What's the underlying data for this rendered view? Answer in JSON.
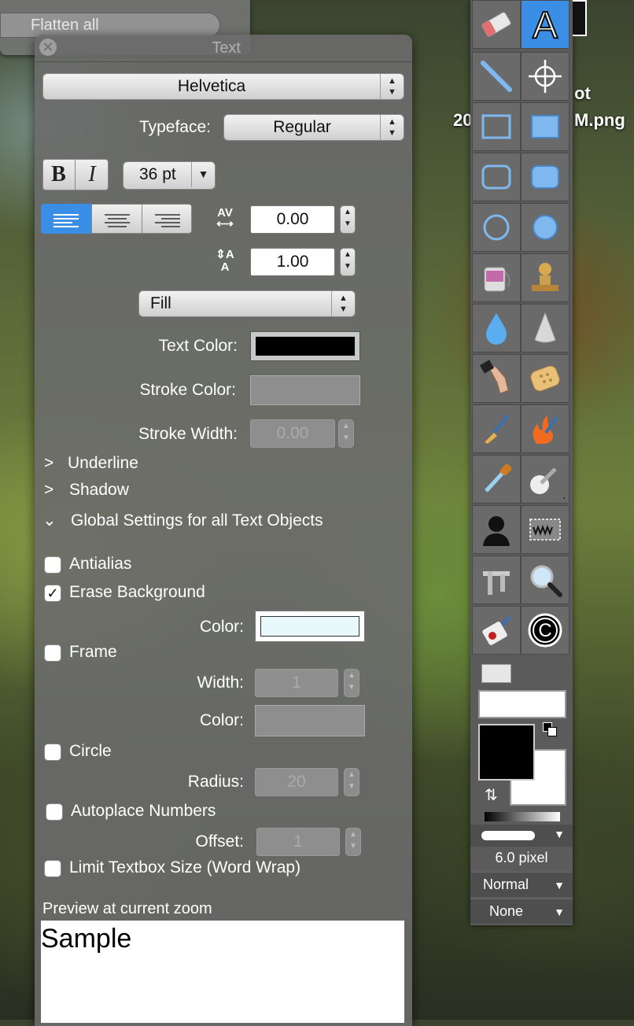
{
  "background_window": {
    "flatten_label": "Flatten all"
  },
  "desktop": {
    "file_label_line1": "ot",
    "file_label_line2_left": "20",
    "file_label_line2_right": "M.png"
  },
  "panel": {
    "title": "Text",
    "font_name": "Helvetica",
    "typeface_label": "Typeface:",
    "typeface_value": "Regular",
    "bold_label": "B",
    "italic_label": "I",
    "font_size": "36 pt",
    "tracking_value": "0.00",
    "line_spacing_value": "1.00",
    "fill_mode": "Fill",
    "text_color_label": "Text Color:",
    "stroke_color_label": "Stroke Color:",
    "stroke_width_label": "Stroke Width:",
    "stroke_width_value": "0.00",
    "underline_label": "Underline",
    "shadow_label": "Shadow",
    "global_settings_label": "Global Settings for all Text Objects",
    "antialias_label": "Antialias",
    "erase_background_label": "Erase Background",
    "color_label": "Color:",
    "frame_label": "Frame",
    "width_label": "Width:",
    "frame_width_value": "1",
    "frame_color_label": "Color:",
    "circle_label": "Circle",
    "radius_label": "Radius:",
    "radius_value": "20",
    "autoplace_label": "Autoplace Numbers",
    "offset_label": "Offset:",
    "offset_value": "1",
    "limit_textbox_label": "Limit Textbox Size (Word Wrap)",
    "preview_label": "Preview at current zoom",
    "preview_sample": "Sample",
    "checks": {
      "antialias": false,
      "erase_background": true,
      "frame": false,
      "circle": false,
      "autoplace": false,
      "limit_textbox": false
    }
  },
  "toolbox": {
    "brush_size": "6.0 pixel",
    "blend_mode": "Normal",
    "fill_option": "None"
  },
  "colors": {
    "text_color": "#000000",
    "erase_bg_color": "#e8f8fb",
    "selected_tool": "#3a8ee6"
  }
}
